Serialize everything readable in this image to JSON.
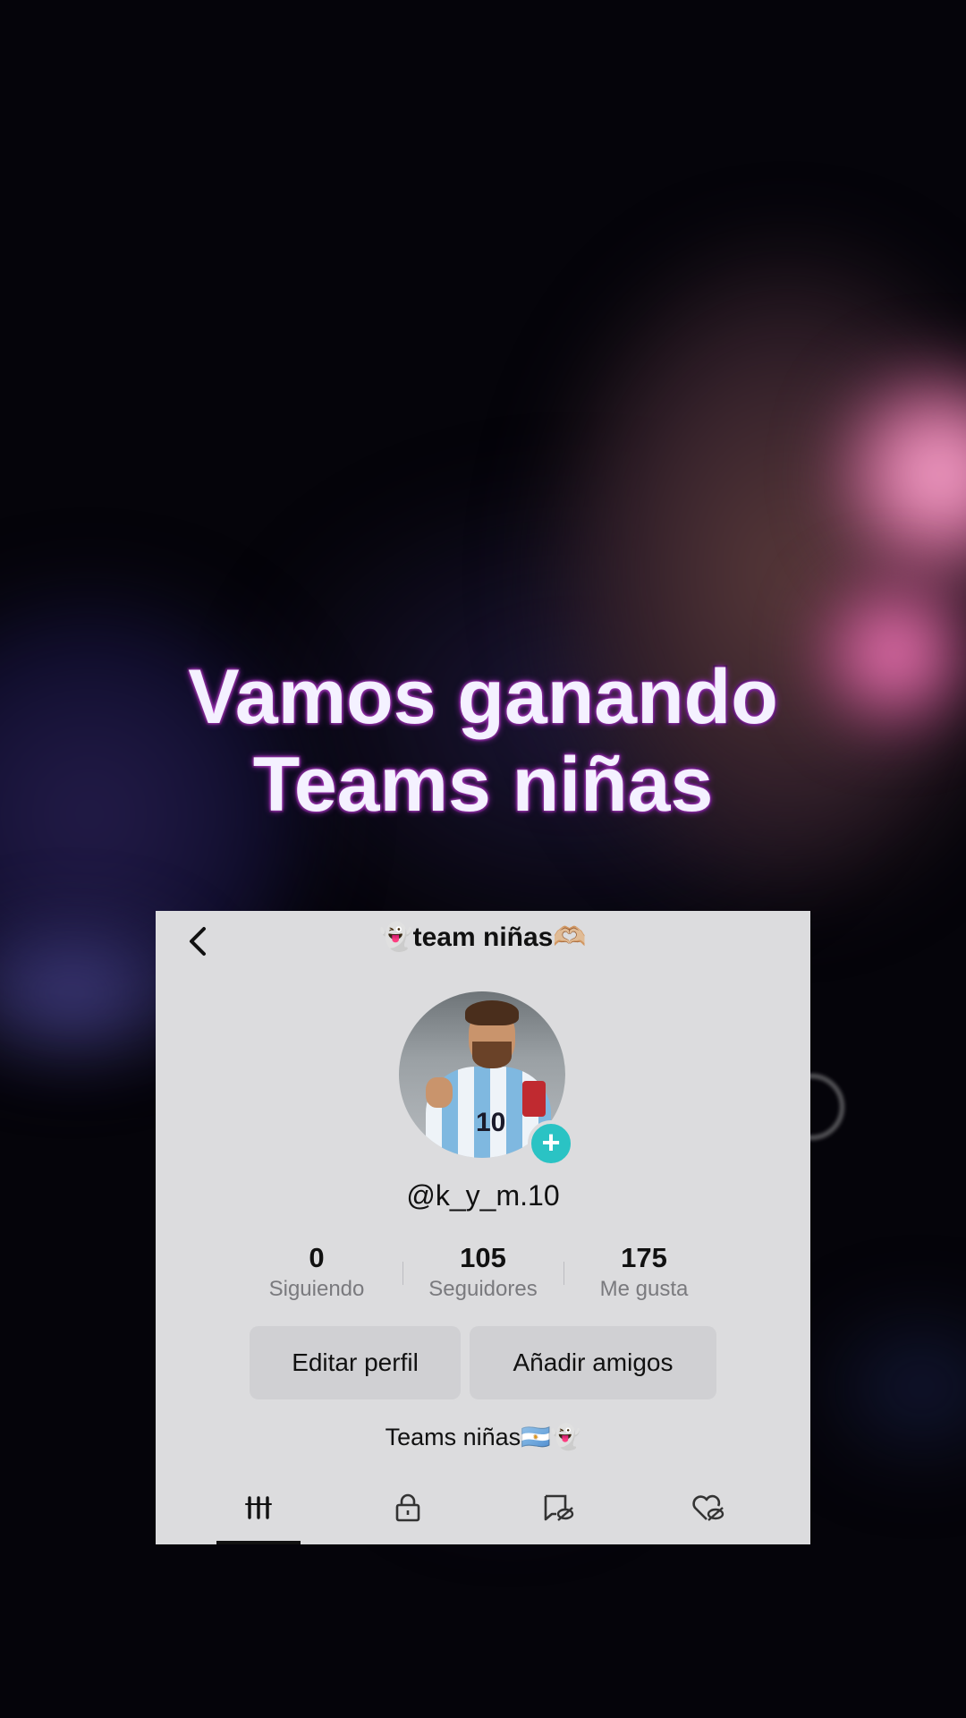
{
  "caption": {
    "line1": "Vamos ganando",
    "line2": "Teams niñas"
  },
  "profile": {
    "title": "👻team niñas🫶🏼",
    "handle": "@k_y_m.10",
    "avatar_number": "10",
    "stats": [
      {
        "value": "0",
        "label": "Siguiendo"
      },
      {
        "value": "105",
        "label": "Seguidores"
      },
      {
        "value": "175",
        "label": "Me gusta"
      }
    ],
    "buttons": {
      "edit": "Editar perfil",
      "add_friends": "Añadir amigos"
    },
    "bio": "Teams niñas🇦🇷👻",
    "tabs": [
      {
        "icon": "videos-grid-icon",
        "selected": true
      },
      {
        "icon": "lock-icon",
        "selected": false
      },
      {
        "icon": "reposts-hidden-icon",
        "selected": false
      },
      {
        "icon": "liked-hidden-icon",
        "selected": false
      }
    ]
  },
  "colors": {
    "follow_badge": "#2ac3c4",
    "panel_bg": "#dcdcde",
    "caption_glow": "#c04bd0"
  }
}
